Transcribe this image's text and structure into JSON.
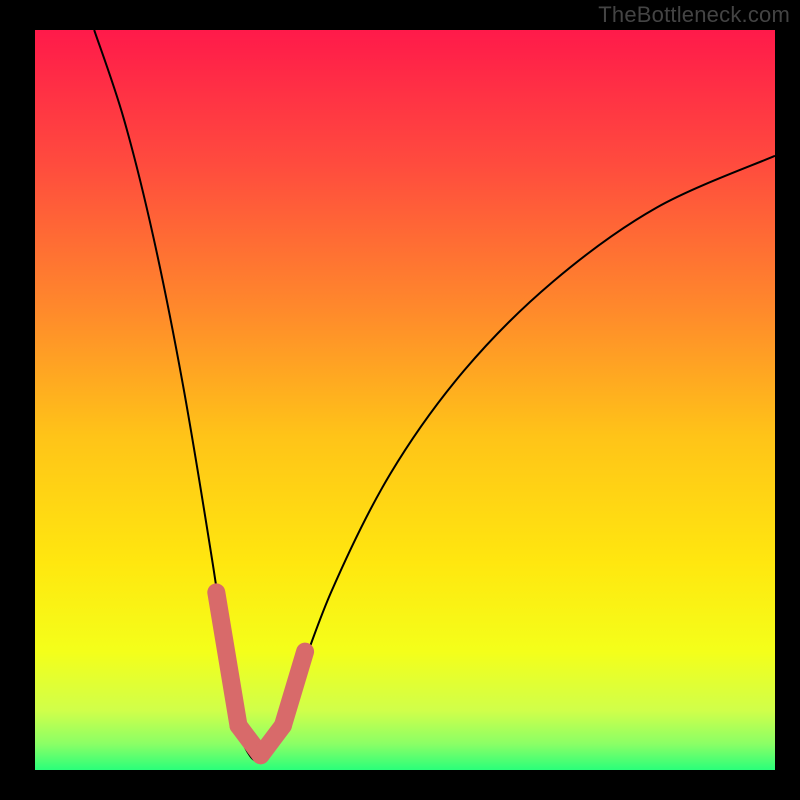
{
  "watermark": "TheBottleneck.com",
  "chart_data": {
    "type": "line",
    "title": "",
    "xlabel": "",
    "ylabel": "",
    "xlim": [
      0,
      100
    ],
    "ylim": [
      0,
      100
    ],
    "curve": {
      "description": "V-shaped bottleneck curve with minimum near x≈29; left branch steep, right branch shallow",
      "minimum_x": 29,
      "minimum_y": 2,
      "points": [
        {
          "x": 8,
          "y": 100
        },
        {
          "x": 12,
          "y": 88
        },
        {
          "x": 16,
          "y": 72
        },
        {
          "x": 20,
          "y": 52
        },
        {
          "x": 24,
          "y": 28
        },
        {
          "x": 27,
          "y": 8
        },
        {
          "x": 29,
          "y": 2
        },
        {
          "x": 31,
          "y": 2
        },
        {
          "x": 34,
          "y": 8
        },
        {
          "x": 40,
          "y": 24
        },
        {
          "x": 48,
          "y": 40
        },
        {
          "x": 58,
          "y": 54
        },
        {
          "x": 70,
          "y": 66
        },
        {
          "x": 84,
          "y": 76
        },
        {
          "x": 100,
          "y": 83
        }
      ]
    },
    "highlight_segments": [
      {
        "from_x": 24.5,
        "to_x": 27.5,
        "from_y": 24,
        "to_y": 6
      },
      {
        "from_x": 27.5,
        "to_x": 30.5,
        "from_y": 6,
        "to_y": 2
      },
      {
        "from_x": 30.5,
        "to_x": 33.5,
        "from_y": 2,
        "to_y": 6
      },
      {
        "from_x": 33.5,
        "to_x": 36.5,
        "from_y": 6,
        "to_y": 16
      }
    ],
    "background_gradient": {
      "type": "vertical",
      "stops": [
        {
          "offset": 0.0,
          "color": "#ff1a4a"
        },
        {
          "offset": 0.18,
          "color": "#ff4b3e"
        },
        {
          "offset": 0.38,
          "color": "#ff8a2b"
        },
        {
          "offset": 0.55,
          "color": "#ffc418"
        },
        {
          "offset": 0.72,
          "color": "#ffe70f"
        },
        {
          "offset": 0.84,
          "color": "#f4ff1a"
        },
        {
          "offset": 0.92,
          "color": "#d0ff4a"
        },
        {
          "offset": 0.965,
          "color": "#8aff66"
        },
        {
          "offset": 1.0,
          "color": "#2aff7a"
        }
      ]
    },
    "colors": {
      "curve": "#000000",
      "highlight": "#d86a6a",
      "frame": "#000000"
    }
  }
}
